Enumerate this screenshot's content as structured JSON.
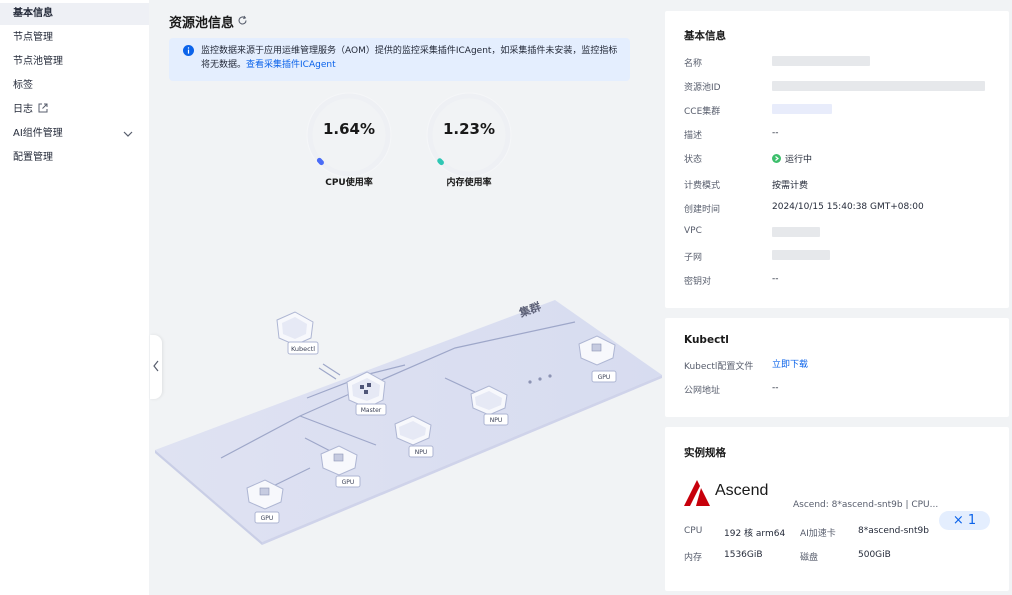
{
  "sidebar": {
    "items": [
      {
        "label": "基本信息",
        "active": true
      },
      {
        "label": "节点管理"
      },
      {
        "label": "节点池管理"
      },
      {
        "label": "标签"
      },
      {
        "label": "日志",
        "icon": "external-link-icon"
      },
      {
        "label": "AI组件管理",
        "icon": "chevron-down-icon"
      },
      {
        "label": "配置管理"
      }
    ]
  },
  "main": {
    "title": "资源池信息",
    "notice": {
      "text": "监控数据来源于应用运维管理服务（AOM）提供的监控采集插件ICAgent，如采集插件未安装，监控指标将无数据。",
      "link": "查看采集插件ICAgent"
    },
    "gauges": [
      {
        "value_text": "1.64%",
        "value": 1.64,
        "label": "CPU使用率",
        "color": "#4a6cf7"
      },
      {
        "value_text": "1.23%",
        "value": 1.23,
        "label": "内存使用率",
        "color": "#2fc7b4"
      }
    ],
    "diagram": {
      "cluster_label": "集群",
      "nodes": [
        "Kubectl",
        "Master",
        "NPU",
        "NPU",
        "GPU",
        "GPU",
        "GPU"
      ]
    }
  },
  "basic_info": {
    "title": "基本信息",
    "rows": [
      {
        "label": "名称",
        "value": ""
      },
      {
        "label": "资源池ID",
        "value": ""
      },
      {
        "label": "CCE集群",
        "value": ""
      },
      {
        "label": "描述",
        "value": "--"
      },
      {
        "label": "状态",
        "value": "运行中"
      },
      {
        "label": "计费模式",
        "value": "按需计费"
      },
      {
        "label": "创建时间",
        "value": "2024/10/15 15:40:38 GMT+08:00"
      },
      {
        "label": "VPC",
        "value": ""
      },
      {
        "label": "子网",
        "value": ""
      },
      {
        "label": "密钥对",
        "value": "--"
      }
    ]
  },
  "kubectl": {
    "title": "Kubectl",
    "config_label": "Kubectl配置文件",
    "config_link": "立即下载",
    "address_label": "公网地址",
    "address_value": "--"
  },
  "spec": {
    "title": "实例规格",
    "brand": "Ascend",
    "flavor": "Ascend: 8*ascend-snt9b | CPU...",
    "cpu_label": "CPU",
    "cpu_value": "192 核 arm64",
    "accel_label": "AI加速卡",
    "accel_value": "8*ascend-snt9b",
    "mem_label": "内存",
    "mem_value": "1536GiB",
    "disk_label": "磁盘",
    "disk_value": "500GiB",
    "quantity": "× 1"
  },
  "colors": {
    "accent": "#0b63ea",
    "running": "#3dbf6c",
    "brand_red": "#c7000b"
  }
}
